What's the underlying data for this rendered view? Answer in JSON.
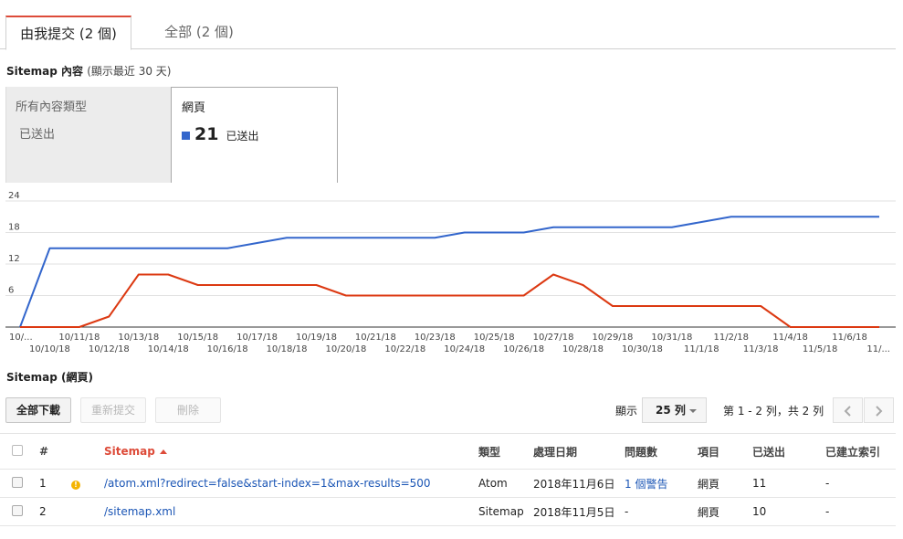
{
  "tabs": [
    {
      "label": "由我提交 (2 個)"
    },
    {
      "label": "全部 (2 個)"
    }
  ],
  "sitemap_content": {
    "title": "Sitemap 內容",
    "subtitle": "(顯示最近 30 天)"
  },
  "cards": {
    "all_types": {
      "label": "所有內容類型",
      "sub_label": "已送出"
    },
    "web": {
      "label": "網頁",
      "value": "21",
      "unit": "已送出",
      "color": "#3366cc"
    }
  },
  "chart_data": {
    "type": "line",
    "x": [
      "10/9/18",
      "10/10/18",
      "10/11/18",
      "10/12/18",
      "10/13/18",
      "10/14/18",
      "10/15/18",
      "10/16/18",
      "10/17/18",
      "10/18/18",
      "10/19/18",
      "10/20/18",
      "10/21/18",
      "10/22/18",
      "10/23/18",
      "10/24/18",
      "10/25/18",
      "10/26/18",
      "10/27/18",
      "10/28/18",
      "10/29/18",
      "10/30/18",
      "10/31/18",
      "11/1/18",
      "11/2/18",
      "11/3/18",
      "11/4/18",
      "11/5/18",
      "11/6/18",
      "11/7/18"
    ],
    "tick_labels_top": [
      "10/...",
      "10/11/18",
      "10/13/18",
      "10/15/18",
      "10/17/18",
      "10/19/18",
      "10/21/18",
      "10/23/18",
      "10/25/18",
      "10/27/18",
      "10/29/18",
      "10/31/18",
      "11/2/18",
      "11/4/18",
      "11/6/18"
    ],
    "tick_labels_bottom": [
      "10/10/18",
      "10/12/18",
      "10/14/18",
      "10/16/18",
      "10/18/18",
      "10/20/18",
      "10/22/18",
      "10/24/18",
      "10/26/18",
      "10/28/18",
      "10/30/18",
      "11/1/18",
      "11/3/18",
      "11/5/18",
      "11/..."
    ],
    "series": [
      {
        "values": [
          0,
          15,
          15,
          15,
          15,
          15,
          15,
          15,
          16,
          17,
          17,
          17,
          17,
          17,
          17,
          18,
          18,
          18,
          19,
          19,
          19,
          19,
          19,
          20,
          21,
          21,
          21,
          21,
          21,
          21
        ],
        "color": "#3366cc"
      },
      {
        "values": [
          0,
          0,
          0,
          2,
          10,
          10,
          8,
          8,
          8,
          8,
          8,
          6,
          6,
          6,
          6,
          6,
          6,
          6,
          10,
          8,
          4,
          4,
          4,
          4,
          4,
          4,
          0,
          0,
          0,
          0
        ],
        "color": "#dc3912"
      }
    ],
    "yticks": [
      6,
      12,
      18,
      24
    ],
    "ylim": [
      0,
      24
    ],
    "grid": true
  },
  "sitemap_web": {
    "title": "Sitemap",
    "subtitle": "(網頁)"
  },
  "toolbar": {
    "download_all": "全部下載",
    "resubmit": "重新提交",
    "delete": "刪除",
    "show_label": "顯示",
    "rows_option": "25 列",
    "range_text": "第 1 - 2 列，共 2 列"
  },
  "table": {
    "headers": {
      "index": "#",
      "sitemap": "Sitemap",
      "type": "類型",
      "processed": "處理日期",
      "issues": "問題數",
      "items": "項目",
      "submitted": "已送出",
      "indexed": "已建立索引"
    },
    "rows": [
      {
        "index": "1",
        "warning": "!",
        "sitemap": "/atom.xml?redirect=false&start-index=1&max-results=500",
        "type": "Atom",
        "processed": "2018年11月6日",
        "issues": "1 個警告",
        "items": "網頁",
        "submitted": "11",
        "indexed": "-"
      },
      {
        "index": "2",
        "warning": "",
        "sitemap": "/sitemap.xml",
        "type": "Sitemap",
        "processed": "2018年11月5日",
        "issues": "-",
        "items": "網頁",
        "submitted": "10",
        "indexed": "-"
      }
    ]
  }
}
